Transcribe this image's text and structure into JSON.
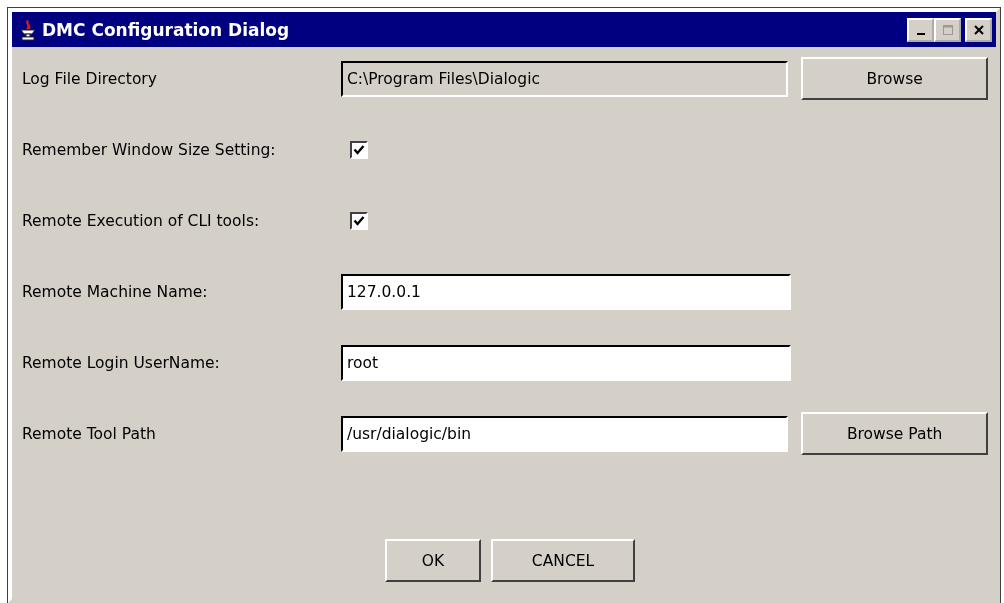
{
  "window": {
    "title": "DMC Configuration Dialog"
  },
  "rows": [
    {
      "kind": "field",
      "label": "Log File Directory",
      "value": "C:\\Program Files\\Dialogic",
      "disabled": true,
      "button": "Browse"
    },
    {
      "kind": "checkbox",
      "label": "Remember Window Size Setting:",
      "checked": true
    },
    {
      "kind": "checkbox",
      "label": "Remote Execution of CLI tools:",
      "checked": true
    },
    {
      "kind": "field",
      "label": "Remote Machine Name:",
      "value": "127.0.0.1",
      "disabled": false
    },
    {
      "kind": "field",
      "label": "Remote Login UserName:",
      "value": "root",
      "disabled": false
    },
    {
      "kind": "field",
      "label": "Remote Tool Path",
      "value": "/usr/dialogic/bin",
      "disabled": false,
      "button": "Browse Path"
    }
  ],
  "buttons": [
    "OK",
    "CANCEL"
  ]
}
